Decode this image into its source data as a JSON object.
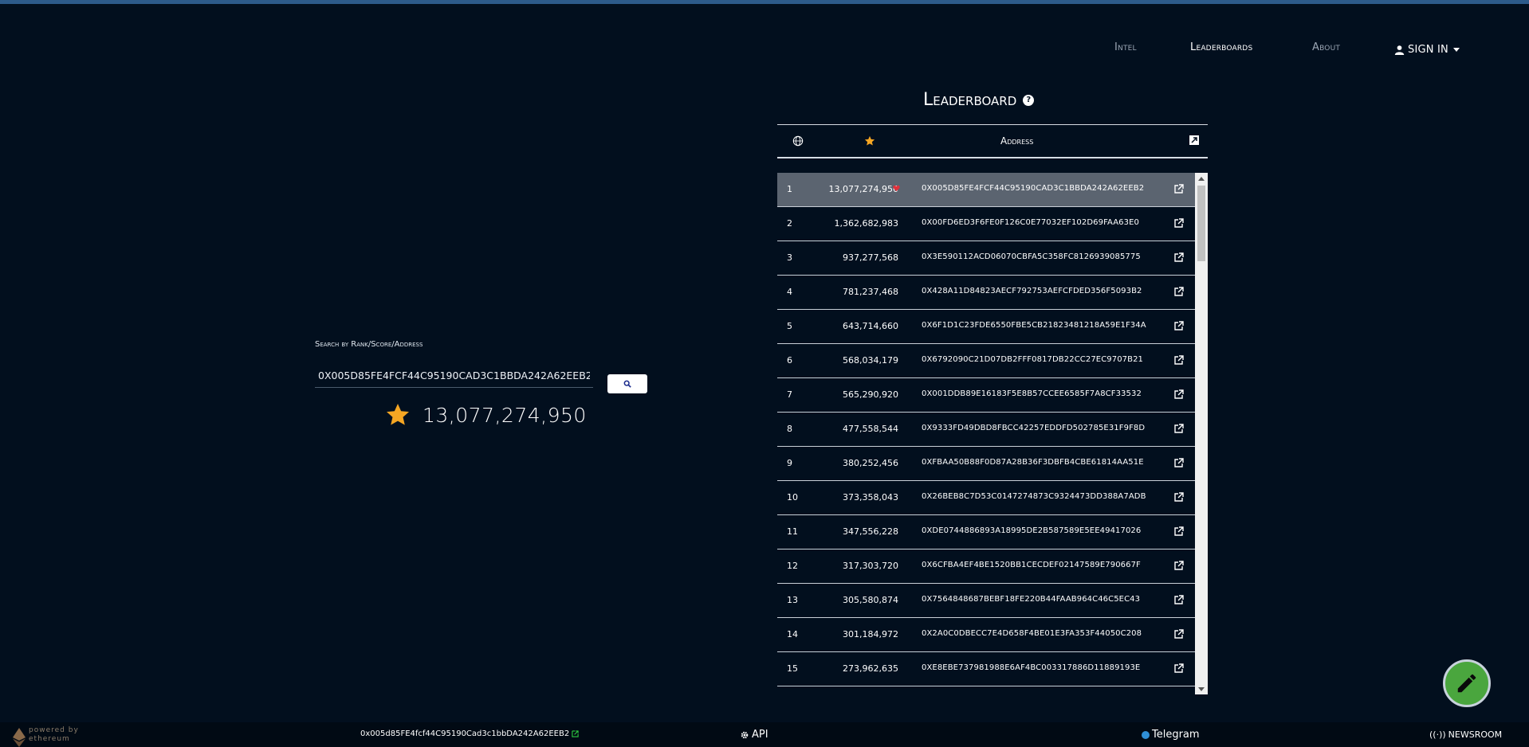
{
  "nav": {
    "intel": "Intel",
    "leaderboards": "Leaderboards",
    "about": "About",
    "sign_in": "SIGN IN"
  },
  "search": {
    "label": "Search by Rank/Score/Address",
    "value": "0X005D85FE4FCF44C95190CAD3C1BBDA242A62EEB2",
    "button_icon": "search-icon",
    "score": "13,077,274,950"
  },
  "leaderboard": {
    "title": "Leaderboard",
    "columns": {
      "rank_icon": "globe-icon",
      "score_icon": "star-icon",
      "address": "Address",
      "link_icon": "external-link-icon"
    },
    "rows": [
      {
        "rank": "1",
        "score": "13,077,274,950",
        "address": "0X005D85FE4FCF44C95190CAD3C1BBDA242A62EEB2",
        "selected": true
      },
      {
        "rank": "2",
        "score": "1,362,682,983",
        "address": "0X00FD6ED3F6FE0F126C0E77032EF102D69FAA63E0"
      },
      {
        "rank": "3",
        "score": "937,277,568",
        "address": "0X3E590112ACD06070CBFA5C358FC8126939085775"
      },
      {
        "rank": "4",
        "score": "781,237,468",
        "address": "0X428A11D84823AECF792753AEFCFDED356F5093B2"
      },
      {
        "rank": "5",
        "score": "643,714,660",
        "address": "0X6F1D1C23FDE6550FBE5CB21823481218A59E1F34A"
      },
      {
        "rank": "6",
        "score": "568,034,179",
        "address": "0X6792090C21D07DB2FFF0817DB22CC27EC9707B21"
      },
      {
        "rank": "7",
        "score": "565,290,920",
        "address": "0X001DDB89E16183F5E8B57CCEE6585F7A8CF33532"
      },
      {
        "rank": "8",
        "score": "477,558,544",
        "address": "0X9333FD49DBD8FBCC42257EDDFD502785E31F9F8D"
      },
      {
        "rank": "9",
        "score": "380,252,456",
        "address": "0XFBAA50B88F0D87A28B36F3DBFB4CBE61814AA51E"
      },
      {
        "rank": "10",
        "score": "373,358,043",
        "address": "0X26BEB8C7D53C0147274873C9324473DD388A7ADB"
      },
      {
        "rank": "11",
        "score": "347,556,228",
        "address": "0XDE0744886893A18995DE2B587589E5EE49417026"
      },
      {
        "rank": "12",
        "score": "317,303,720",
        "address": "0X6CFBA4EF4BE1520BB1CECDEF02147589E790667F"
      },
      {
        "rank": "13",
        "score": "305,580,874",
        "address": "0X7564848687BEBF18FE220B44FAAB964C46C5EC43"
      },
      {
        "rank": "14",
        "score": "301,184,972",
        "address": "0X2A0C0DBECC7E4D658F4BE01E3FA353F44050C208"
      },
      {
        "rank": "15",
        "score": "273,962,635",
        "address": "0XE8EBE737981988E6AF4BC003317886D11889193E"
      }
    ]
  },
  "footer": {
    "powered_by": "powered by",
    "ethereum": "ethereum",
    "address": "0x005d85FE4fcf44C95190Cad3c1bbDA242A62EEB2",
    "api": "API",
    "telegram": "Telegram",
    "newsroom": "NEWSROOM"
  },
  "colors": {
    "background": "#020f1e",
    "star": "#f5a623",
    "selected_row": "#5b6470",
    "heart": "#e0323c",
    "fab": "#4aa63e"
  }
}
